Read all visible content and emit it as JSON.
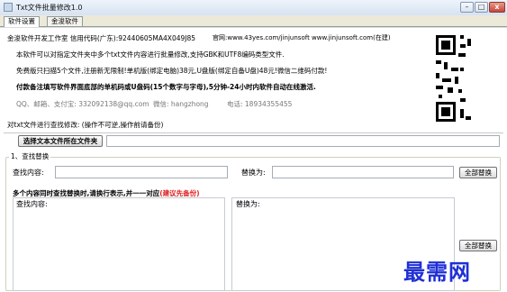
{
  "window": {
    "title": "Txt文件批量修改1.0",
    "controls": {
      "minimize": "–",
      "maximize": "□",
      "close": "x"
    }
  },
  "tabs": [
    {
      "label": "软件设置",
      "active": true
    },
    {
      "label": "金浚软件",
      "active": false
    }
  ],
  "info": {
    "line1_left": "金浚软件开发工作室 信用代码(广东):92440605MA4X049J85",
    "line1_right": "官网:www.43yes.com/jinjunsoft  www.jinjunsoft.com(在建)",
    "line2": "本软件可以对指定文件夹中多个txt文件内容进行批量修改,支持GBK和UTF8编码类型文件.",
    "line3": "免费版只扫描5个文件,注册新无限制!单机版(绑定电脑)38元,U盘版(绑定自备U盘)48元!微信二维码付款!",
    "line4": "付款备注填写软件界面底部的单机码或U盘码(15个数字与字母),5分钟-24小时内软件自动在线激活.",
    "line5_left": "QQ、邮箱、支付宝: 332092138@qq.com",
    "line5_mid": "微信: hangzhong",
    "line5_right": "电话: 18934355455"
  },
  "section": {
    "header": "对txt文件进行查找修改: (操作不可逆,操作前请备份)",
    "choose_folder_button": "选择文本文件所在文件夹",
    "group_title": "1、查找替换",
    "find_label": "查找内容:",
    "replace_label": "替换为:",
    "replace_all_button": "全部替换",
    "multi_header": "多个内容同时查找替换时,请换行表示,并一一对应",
    "multi_header_note": "(建议先备份)",
    "multi_find_label": "查找内容:",
    "multi_replace_label": "替换为:",
    "replace_all_button2": "全部替换"
  },
  "watermark": "最需网"
}
